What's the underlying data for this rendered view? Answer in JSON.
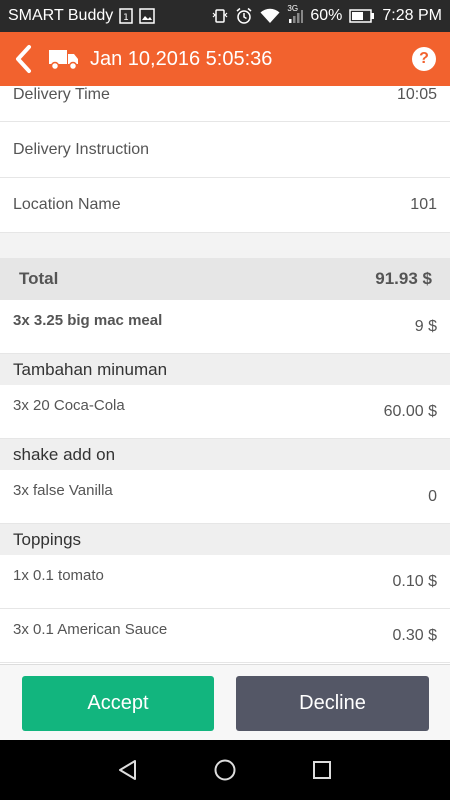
{
  "status_bar": {
    "app_name": "SMART Buddy",
    "network": "3G",
    "battery": "60%",
    "time": "7:28 PM"
  },
  "header": {
    "title": "Jan 10,2016 5:05:36",
    "help_label": "?"
  },
  "details": [
    {
      "label": "Delivery Time",
      "value": "10:05"
    },
    {
      "label": "Delivery Instruction",
      "value": ""
    },
    {
      "label": "Location Name",
      "value": "101"
    }
  ],
  "total": {
    "label": "Total",
    "value": "91.93 $"
  },
  "main_item": {
    "label": "3x 3.25 big mac meal",
    "value": "9 $"
  },
  "sections": [
    {
      "title": "Tambahan minuman",
      "items": [
        {
          "label": "3x 20 Coca-Cola",
          "value": "60.00 $"
        }
      ]
    },
    {
      "title": "shake add on",
      "items": [
        {
          "label": "3x false Vanilla",
          "value": "0"
        }
      ]
    },
    {
      "title": "Toppings",
      "items": [
        {
          "label": "1x 0.1 tomato",
          "value": "0.10 $"
        },
        {
          "label": "3x 0.1 American Sauce",
          "value": "0.30 $"
        }
      ]
    }
  ],
  "actions": {
    "accept": "Accept",
    "decline": "Decline"
  },
  "colors": {
    "header": "#f2622e",
    "accept": "#12b57e",
    "decline": "#545766"
  }
}
